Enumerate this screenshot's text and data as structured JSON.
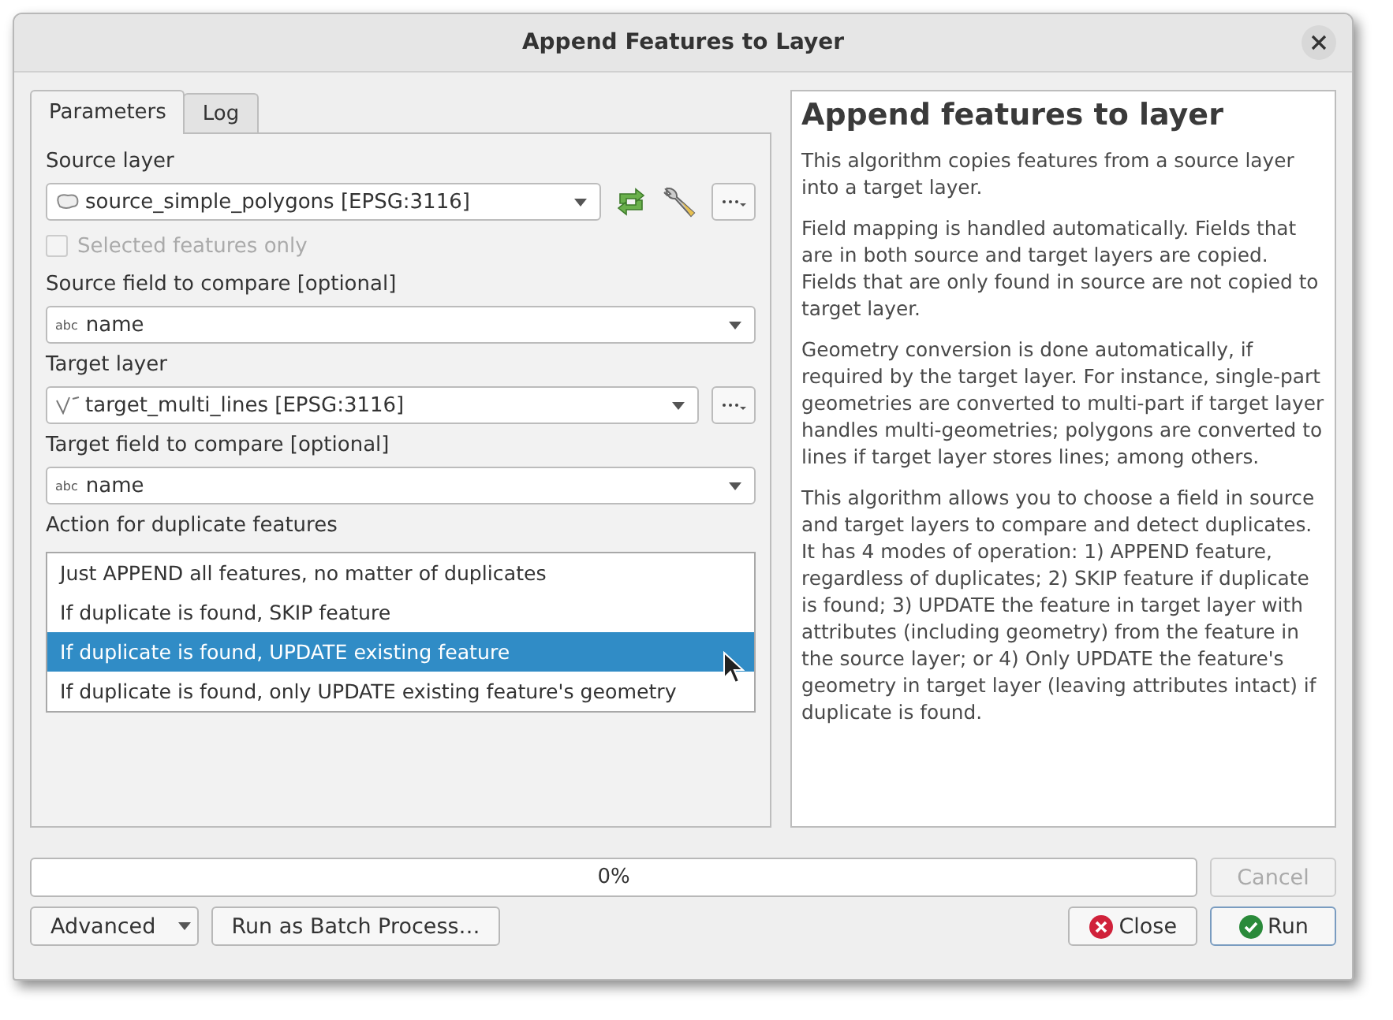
{
  "window": {
    "title": "Append Features to Layer"
  },
  "tabs": [
    {
      "label": "Parameters",
      "selected": true
    },
    {
      "label": "Log",
      "selected": false
    }
  ],
  "params": [
    {
      "kind": "polygon_layer",
      "label": "Source layer",
      "value": "source_simple_polygons [EPSG:3116]",
      "iterate": true
    },
    {
      "kind": "checkbox",
      "label": "Selected features only",
      "checked": false,
      "disabled": true
    },
    {
      "kind": "field",
      "label": "Source field to compare [optional]",
      "type_tag": "abc",
      "value": "name"
    },
    {
      "kind": "line_layer",
      "label": "Target layer",
      "value": "target_multi_lines [EPSG:3116]",
      "iterate": false
    },
    {
      "kind": "field",
      "label": "Target field to compare [optional]",
      "type_tag": "abc",
      "value": "name"
    },
    {
      "kind": "list",
      "label": "Action for duplicate features",
      "options": [
        {
          "label": "Just APPEND all features, no matter of duplicates",
          "selected": false
        },
        {
          "label": "If duplicate is found, SKIP feature",
          "selected": false
        },
        {
          "label": "If duplicate is found, UPDATE existing feature",
          "selected": true
        },
        {
          "label": "If duplicate is found, only UPDATE existing feature's geometry",
          "selected": false
        }
      ]
    }
  ],
  "help": {
    "title": "Append features to layer",
    "paragraphs": [
      "This algorithm copies features from a source layer into a target layer.",
      "Field mapping is handled automatically. Fields that are in both source and target layers are copied. Fields that are only found in source are not copied to target layer.",
      "Geometry conversion is done automatically, if required by the target layer. For instance, single-part geometries are converted to multi-part if target layer handles multi-geometries; polygons are converted to lines if target layer stores lines; among others.",
      "This algorithm allows you to choose a field in source and target layers to compare and detect duplicates. It has 4 modes of operation: 1) APPEND feature, regardless of duplicates; 2) SKIP feature if duplicate is found; 3) UPDATE the feature in target layer with attributes (including geometry) from the feature in the source layer; or 4) Only UPDATE the feature's geometry in target layer (leaving attributes intact) if duplicate is found."
    ]
  },
  "progress": {
    "level": 0,
    "reading": "0%"
  },
  "cancel": {
    "label": "Cancel",
    "disabled": true
  },
  "advanced": {
    "label": "Advanced"
  },
  "batch": {
    "label": "Run as Batch Process…"
  },
  "close": {
    "label": "Close"
  },
  "run": {
    "label": "Run"
  }
}
